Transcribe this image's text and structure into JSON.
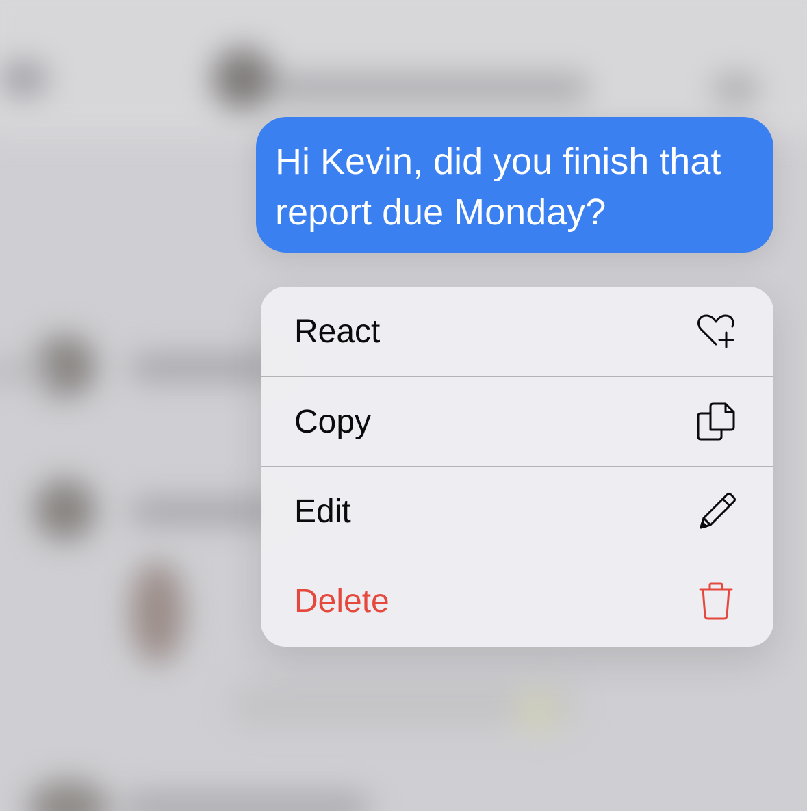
{
  "message": {
    "text": "Hi Kevin, did you finish that report due Monday?",
    "bubble_color": "#3b80f1",
    "text_color": "#ffffff"
  },
  "context_menu": {
    "items": [
      {
        "label": "React",
        "icon": "heart-plus-icon",
        "color": "#0b0b0d"
      },
      {
        "label": "Copy",
        "icon": "copy-icon",
        "color": "#0b0b0d"
      },
      {
        "label": "Edit",
        "icon": "pencil-icon",
        "color": "#0b0b0d"
      },
      {
        "label": "Delete",
        "icon": "trash-icon",
        "color": "#e5483d"
      }
    ]
  },
  "colors": {
    "background": "#cfcfd3",
    "menu_background": "#efeff2",
    "destructive": "#e5483d"
  }
}
